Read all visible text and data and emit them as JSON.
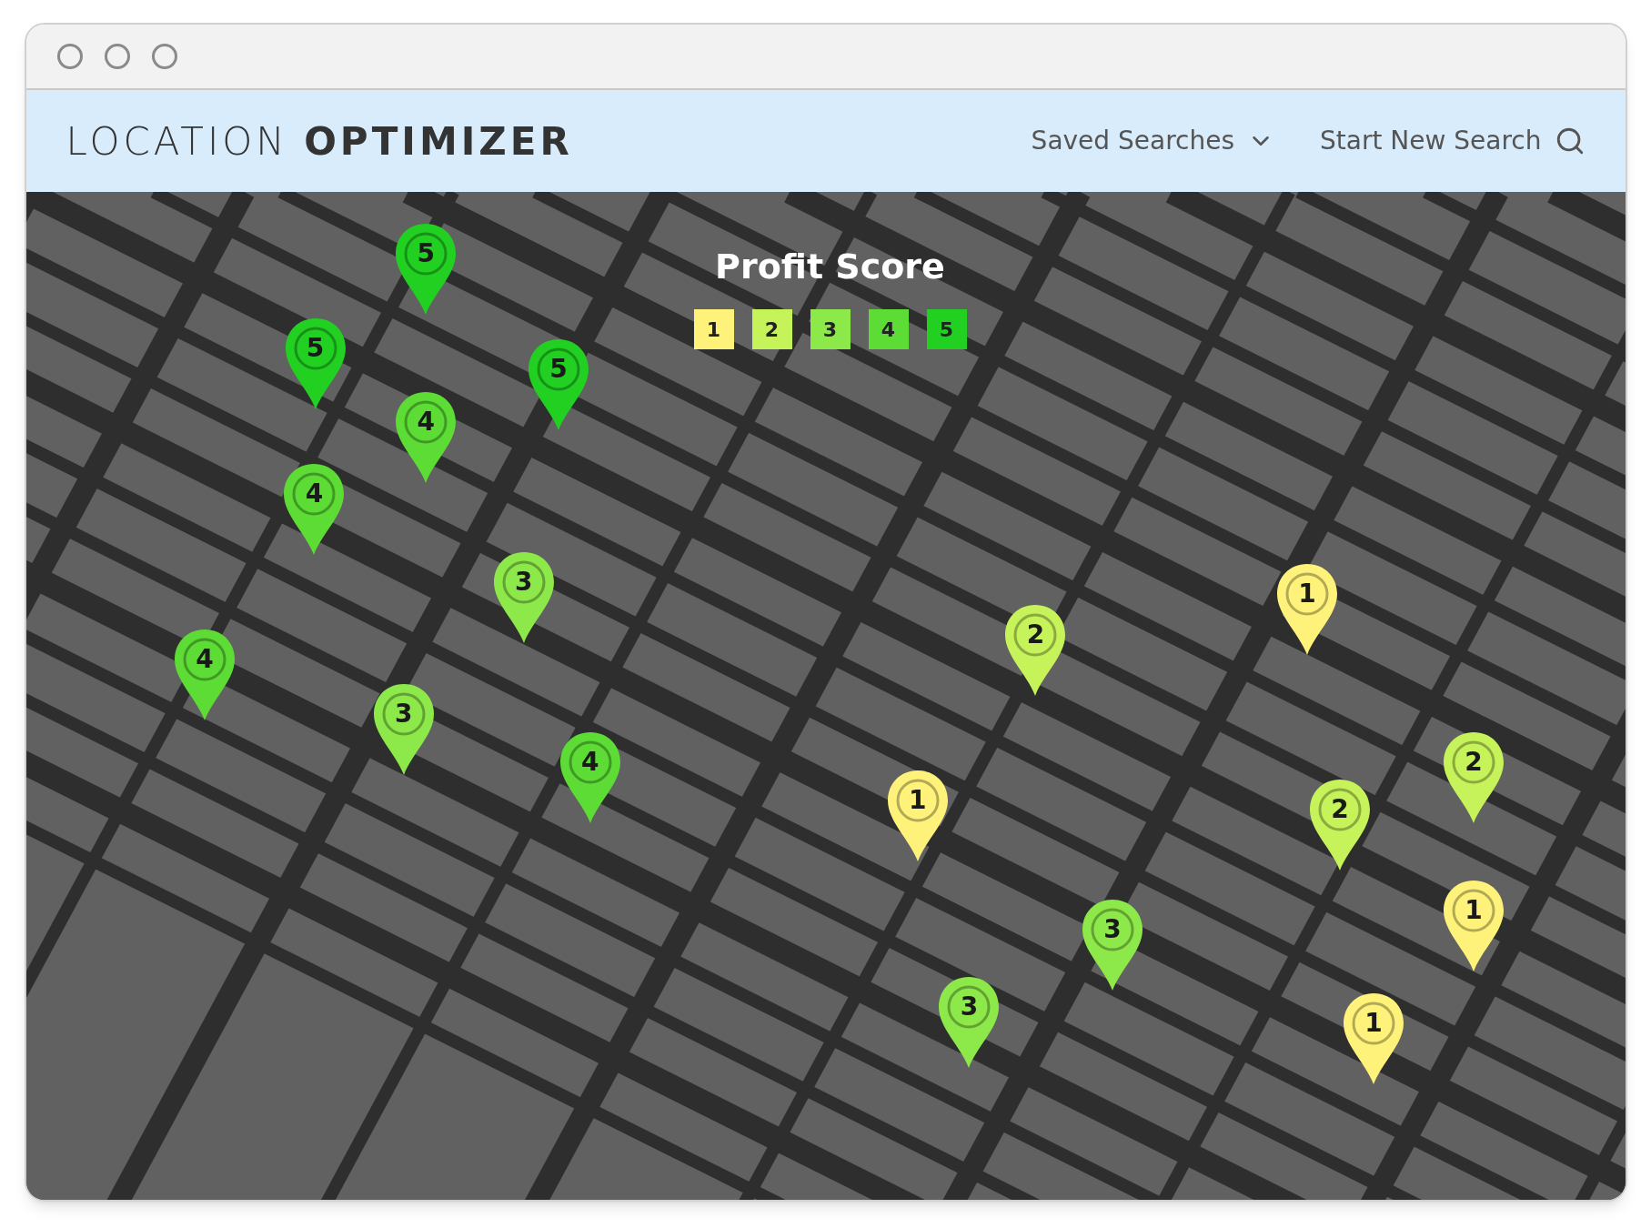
{
  "header": {
    "title_light": "LOCATION",
    "title_bold": "OPTIMIZER",
    "nav": [
      {
        "kind": "dropdown",
        "label": "Saved Searches"
      },
      {
        "kind": "search",
        "label": "Start New Search"
      }
    ]
  },
  "legend": {
    "title": "Profit Score",
    "items": [
      {
        "label": "1",
        "color": "#fff27a"
      },
      {
        "label": "2",
        "color": "#c6f25a"
      },
      {
        "label": "3",
        "color": "#8de84a"
      },
      {
        "label": "4",
        "color": "#5cdc34"
      },
      {
        "label": "5",
        "color": "#22d022"
      }
    ]
  },
  "pins": [
    {
      "label": "5",
      "color": "#22d022"
    },
    {
      "label": "5",
      "color": "#22d022"
    },
    {
      "label": "5",
      "color": "#22d022"
    },
    {
      "label": "4",
      "color": "#5cdc34"
    },
    {
      "label": "4",
      "color": "#5cdc34"
    },
    {
      "label": "3",
      "color": "#8de84a"
    },
    {
      "label": "4",
      "color": "#5cdc34"
    },
    {
      "label": "3",
      "color": "#8de84a"
    },
    {
      "label": "4",
      "color": "#5cdc34"
    },
    {
      "label": "2",
      "color": "#c6f25a"
    },
    {
      "label": "1",
      "color": "#fff27a"
    },
    {
      "label": "1",
      "color": "#fff27a"
    },
    {
      "label": "2",
      "color": "#c6f25a"
    },
    {
      "label": "2",
      "color": "#c6f25a"
    },
    {
      "label": "3",
      "color": "#8de84a"
    },
    {
      "label": "1",
      "color": "#fff27a"
    },
    {
      "label": "3",
      "color": "#8de84a"
    },
    {
      "label": "1",
      "color": "#fff27a"
    }
  ]
}
